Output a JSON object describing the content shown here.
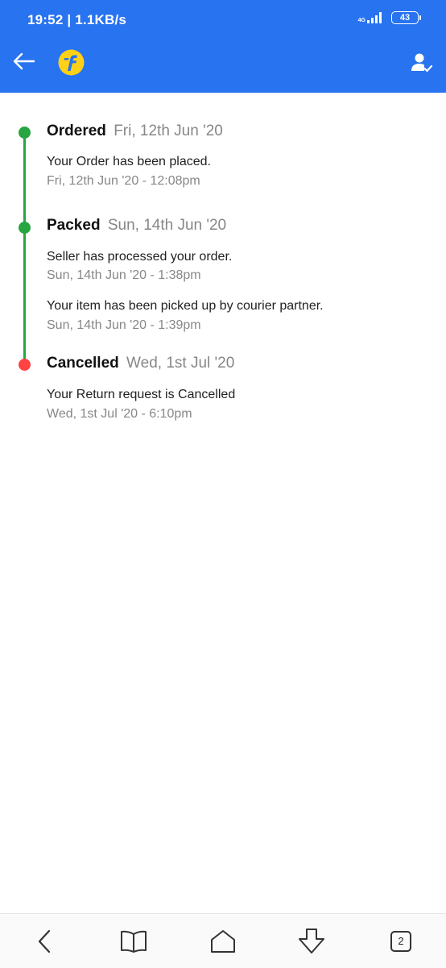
{
  "status_bar": {
    "time_speed": "19:52 | 1.1KB/s",
    "network": "4G",
    "battery": "43"
  },
  "app_bar": {
    "back_icon": "arrow-left-icon",
    "logo_icon": "flipkart-logo-icon",
    "account_icon": "account-check-icon"
  },
  "timeline": {
    "stages": [
      {
        "name": "Ordered",
        "date": "Fri, 12th Jun '20",
        "color": "#26a541",
        "events": [
          {
            "text": "Your Order has been placed.",
            "time": "Fri, 12th Jun '20 - 12:08pm"
          }
        ]
      },
      {
        "name": "Packed",
        "date": "Sun, 14th Jun '20",
        "color": "#26a541",
        "events": [
          {
            "text": "Seller has processed your order.",
            "time": "Sun, 14th Jun '20 - 1:38pm"
          },
          {
            "text": "Your item has been picked up by courier partner.",
            "time": "Sun, 14th Jun '20 - 1:39pm"
          }
        ]
      },
      {
        "name": "Cancelled",
        "date": "Wed, 1st Jul '20",
        "color": "#ff4343",
        "events": [
          {
            "text": "Your Return request is Cancelled",
            "time": "Wed, 1st Jul '20 - 6:10pm"
          }
        ]
      }
    ]
  },
  "nav_bar": {
    "tabs_count": "2",
    "icons": [
      "back-icon",
      "bookmarks-icon",
      "home-icon",
      "download-icon",
      "tabs-icon"
    ]
  },
  "colors": {
    "brand_blue": "#2873f0",
    "success_green": "#26a541",
    "cancel_red": "#ff4343"
  }
}
